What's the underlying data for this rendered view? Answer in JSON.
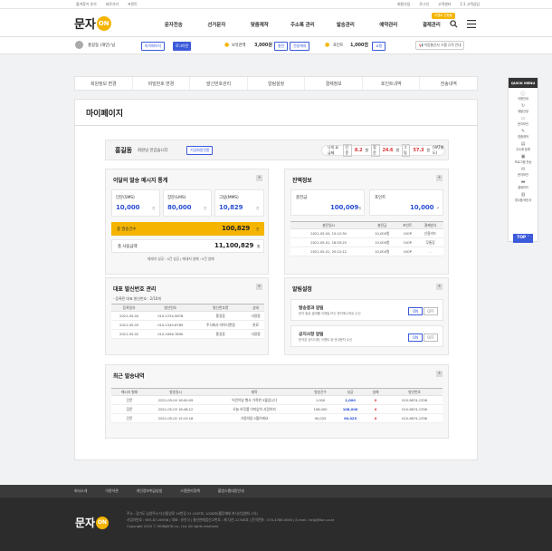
{
  "topbar": {
    "left_links": [
      "즐겨찾기 추가",
      "바로가기",
      "프린트"
    ],
    "right_links": [
      "회원가입",
      "로그인",
      "고객센터",
      "1:1 고객상담"
    ]
  },
  "header": {
    "logo_text": "문자",
    "logo_badge": "ON",
    "nav": [
      "문자전송",
      "선거문자",
      "맞춤제작",
      "주소록 관리",
      "발송관리",
      "예약관리",
      "결제관리"
    ],
    "event_badge": "이벤트 진행중",
    "search_icon": "search-icon",
    "menu_icon": "hamburger-icon"
  },
  "userbar": {
    "name": "홍길동 (개인) 님",
    "mypage_btn": "마이페이지",
    "logout_btn": "로그아웃",
    "balance_label": "보유잔액",
    "balance_value": "3,000원",
    "charge_btn": "충전",
    "charge_history_btn": "전용계좌",
    "point_label": "포인트",
    "point_value": "1,000점",
    "point_btn": "교환",
    "notice": "이동통신사 스팸 규격 안내"
  },
  "tabs": [
    "회원정보 변경",
    "비밀번호 변경",
    "발신번호관리",
    "알림설정",
    "결제정보",
    "포인트내역",
    "전송내역"
  ],
  "page_title": "마이페이지",
  "greeting": {
    "name": "홍길동",
    "text": "회원님 반갑습니다",
    "btn": "기업회원전환",
    "rate_label": "나의 요금제",
    "rates": [
      {
        "label": "단문",
        "value": "8.2",
        "unit": "원"
      },
      {
        "label": "장문",
        "value": "24.6",
        "unit": "원"
      },
      {
        "label": "그림",
        "value": "57.3",
        "unit": "원"
      }
    ],
    "vat": "(VAT별도)"
  },
  "stats": {
    "title": "이달의 발송 메시지 통계",
    "boxes": [
      {
        "label": "단문(SMS)",
        "value": "10,000",
        "unit": "건"
      },
      {
        "label": "장문(LMS)",
        "value": "80,000",
        "unit": "건"
      },
      {
        "label": "그림(MMS)",
        "value": "10,829",
        "unit": "건"
      }
    ],
    "total_label": "총 발송건수",
    "total_value": "100,829",
    "total_unit": "건",
    "amount_label": "총 사용금액",
    "amount_value": "11,100,829",
    "amount_unit": "원",
    "note": "메세지 성공 : 0건 성공  |  메세지 실패 : 0건 실패"
  },
  "balance": {
    "title": "잔액정보",
    "charge_label": "충전금",
    "charge_value": "100,009",
    "charge_unit": "원",
    "point_label": "포인트",
    "point_value": "10,000",
    "point_unit": "P",
    "headers": [
      "충전일시",
      "충전금",
      "포인트",
      "결제방식"
    ],
    "rows": [
      [
        "2021-05-04, 15:12:30",
        "10,000원",
        "100P",
        "신용카드"
      ],
      [
        "2021-05-01, 18:55:25",
        "10,000원",
        "100P",
        "무통장"
      ],
      [
        "2021-05-01, 20:22:12",
        "10,000원",
        "100P",
        "-"
      ]
    ]
  },
  "sender": {
    "title": "대표 발신번호 관리",
    "note": "- 등록된 대표 발신번호 : 2/10개",
    "headers": [
      "등록일자",
      "발신번호",
      "발신번호명",
      "상태"
    ],
    "rows": [
      [
        "2021-05-04",
        "010-1234-5678",
        "홍길동",
        "사용중"
      ],
      [
        "2021-05-03",
        "010-2345-6789",
        "주식회사 마이티앤엠",
        "완료"
      ],
      [
        "2021-05-02",
        "010-3456-7890",
        "홍길동",
        "사용중"
      ]
    ]
  },
  "alarm": {
    "title": "알림설정",
    "items": [
      {
        "title": "발송결과 알림",
        "desc": "문자 발송 결과를 이메일 또는 문자메시지로 수신",
        "on": "ON",
        "off": "OFF"
      },
      {
        "title": "공지사항 알림",
        "desc": "문자온 공지사항, 이벤트 등 안내문자 수신",
        "on": "ON",
        "off": "OFF"
      }
    ]
  },
  "recent": {
    "title": "최근 발송내역",
    "headers": [
      "메시지 형태",
      "발송일시",
      "제목",
      "발송건수",
      "성공",
      "실패",
      "발신번호"
    ],
    "rows": [
      [
        "단문",
        "2021-05-04  18:00:09",
        "어린이날 행사 가족한 5월입니다",
        "1,000",
        "1,000",
        "0",
        "010-9874-1356"
      ],
      [
        "장문",
        "2021-05-03  16:48:12",
        "오늘 하루를 아끼없이 사랑하자",
        "108,000",
        "108,000",
        "0",
        "010-9874-1356"
      ],
      [
        "단문",
        "2021-05-02  15:15:16",
        "가정의달 5월이에요",
        "90,025",
        "90,025",
        "0",
        "010-9874-1356"
      ]
    ]
  },
  "quick_menu": {
    "title": "QUICK MENU",
    "items": [
      "이용안내",
      "재발신정",
      "문자보관",
      "맞춤제작",
      "주소록 등록",
      "프로그램 전송",
      "문자보관",
      "결제관리",
      "영수증/계산서"
    ],
    "top": "TOP"
  },
  "footer": {
    "links": [
      "회사소개",
      "이용약관",
      "개인정보취급방침",
      "스팸관리정책",
      "불법스팸대응안내"
    ],
    "logo_text": "문자",
    "logo_badge": "ON",
    "lines": [
      "주소 : 경기도 남양주시 다산중앙로 19번길 21 102F호, 102B호(웰루체테 지식산업센터 1차)",
      "사업자번호 : 653-87-00958  |  대표 : 유인식  |  통신판매업신고번호 : 제 다산-12345호  |  문의전화 : 070-4786-0000  |  E-mail : help@tlon.co.kr",
      "Copyright 2020 ⓒ MUNJAON co., Ltd. All rights reserved."
    ]
  }
}
